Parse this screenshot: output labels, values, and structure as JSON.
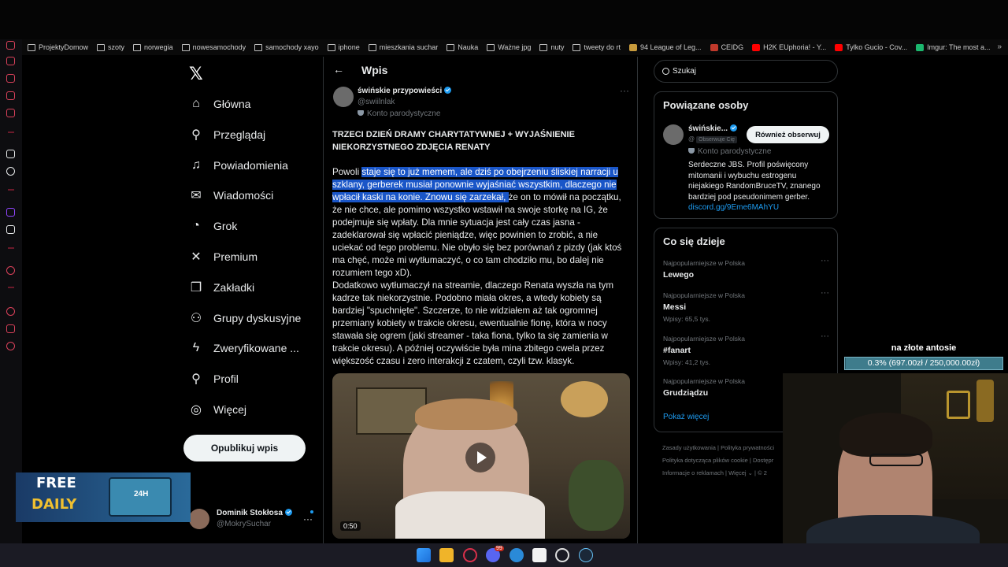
{
  "bookmarks": [
    {
      "label": "ProjektyDomow",
      "icon": "folder-icon"
    },
    {
      "label": "szoty",
      "icon": "folder-icon"
    },
    {
      "label": "norwegia",
      "icon": "folder-icon"
    },
    {
      "label": "nowesamochody",
      "icon": "folder-icon"
    },
    {
      "label": "samochody xayo",
      "icon": "folder-icon"
    },
    {
      "label": "iphone",
      "icon": "folder-icon"
    },
    {
      "label": "mieszkania suchar",
      "icon": "folder-icon"
    },
    {
      "label": "Nauka",
      "icon": "folder-icon"
    },
    {
      "label": "Ważne jpg",
      "icon": "folder-icon"
    },
    {
      "label": "nuty",
      "icon": "folder-icon"
    },
    {
      "label": "tweety do rt",
      "icon": "folder-icon"
    },
    {
      "label": "94 League of Leg...",
      "icon": "league-icon"
    },
    {
      "label": "CEIDG",
      "icon": "ceidg-icon"
    },
    {
      "label": "H2K EUphoria! - Y...",
      "icon": "youtube-icon"
    },
    {
      "label": "Tylko Gucio - Cov...",
      "icon": "youtube-icon"
    },
    {
      "label": "Imgur: The most a...",
      "icon": "imgur-icon"
    }
  ],
  "bookmarks_more": "»",
  "nav": {
    "items": [
      {
        "label": "Główna",
        "icon": "home-icon"
      },
      {
        "label": "Przeglądaj",
        "icon": "search-icon"
      },
      {
        "label": "Powiadomienia",
        "icon": "bell-icon"
      },
      {
        "label": "Wiadomości",
        "icon": "mail-icon"
      },
      {
        "label": "Grok",
        "icon": "grok-icon"
      },
      {
        "label": "Premium",
        "icon": "x-logo-icon"
      },
      {
        "label": "Zakładki",
        "icon": "bookmark-icon"
      },
      {
        "label": "Grupy dyskusyjne",
        "icon": "people-icon"
      },
      {
        "label": "Zweryfikowane ...",
        "icon": "lightning-icon"
      },
      {
        "label": "Profil",
        "icon": "person-icon"
      },
      {
        "label": "Więcej",
        "icon": "more-circle-icon"
      }
    ],
    "post_button": "Opublikuj wpis",
    "account": {
      "name": "Dominik Stokłosa",
      "handle": "@MokrySuchar",
      "menu": "···"
    }
  },
  "main": {
    "back": "←",
    "title": "Wpis",
    "author": {
      "name": "świńskie przypowieści",
      "handle": "@swiilnlak",
      "label": "Konto parodystyczne",
      "menu": "···"
    },
    "heading": "TRZECI DZIEŃ DRAMY CHARYTATYWNEJ + WYJAŚNIENIE NIEKORZYSTNEGO ZDJĘCIA RENATY",
    "body_start": "Powoli ",
    "body_highlight": "staje się to już memem, ale dziś po obejrzeniu śliskiej narracji u szklany, gerberek musiał ponownie wyjaśniać wszystkim, dlaczego nie wpłacił kaski na konie. Znowu się zarzekał, ",
    "body_rest": "że on to mówił na początku, że nie chce, ale pomimo wszystko wstawił na swoje storkę na IG, że podejmuje się wpłaty. Dla mnie sytuacja jest cały czas jasna - zadeklarował się wpłacić pieniądze, więc powinien to zrobić, a nie uciekać od tego problemu. Nie obyło się bez porównań z pizdy (jak ktoś ma chęć, może mi wytłumaczyć, o co tam chodziło mu, bo dalej nie rozumiem tego xD).",
    "body_p2": "Dodatkowo wytłumaczył na streamie, dlaczego Renata wyszła na tym kadrze tak niekorzystnie. Podobno miała okres, a wtedy kobiety są bardziej \"spuchnięte\". Szczerze, to nie widziałem aż tak ogromnej przemiany kobiety w trakcie okresu, ewentualnie fionę, która w nocy stawała się ogrem (jaki streamer - taka fiona, tylko ta się zamienia w trakcie okresu). A później oczywiście była mina zbitego cwela przez większość czasu i zero interakcji z czatem, czyli tzw. klasyk.",
    "video_duration": "0:50"
  },
  "search": {
    "value": "Szukaj"
  },
  "related": {
    "title": "Powiązane osoby",
    "name": "świńskie...",
    "handle": "@",
    "follows_badge": "Obserwuje Cię",
    "follow_button": "Również obserwuj",
    "label": "Konto parodystyczne",
    "bio": "Serdeczne JBS. Profil poświęcony mitomanii i wybuchu estrogenu niejakiego RandomBruceTV, znanego bardziej pod pseudonimem gerber.",
    "link": "discord.gg/9Eme6MAhYU"
  },
  "trends": {
    "title": "Co się dzieje",
    "items": [
      {
        "context": "Najpopularniejsze w Polska",
        "topic": "Lewego",
        "count": ""
      },
      {
        "context": "Najpopularniejsze w Polska",
        "topic": "Messi",
        "count": "Wpisy: 65,5 tys."
      },
      {
        "context": "Najpopularniejsze w Polska",
        "topic": "#fanart",
        "count": "Wpisy: 41,2 tys."
      },
      {
        "context": "Najpopularniejsze w Polska",
        "topic": "Grudziądzu",
        "count": ""
      }
    ],
    "show_more": "Pokaż więcej",
    "menu": "···"
  },
  "footer": {
    "terms": "Zasady użytkowania",
    "privacy": "Polityka prywatności",
    "cookies": "Polityka dotycząca plików cookie",
    "access": "Dostępr",
    "ads": "Informacje o reklamach",
    "more": "Więcej ⌄",
    "copy": "© 2"
  },
  "stream": {
    "goal_title": "na złote antosie",
    "goal_text": "0.3% (697.00zł / 250,000.00zł)",
    "goal_progress": 0.003,
    "promo_free": "FREE",
    "promo_daily": "DAILY",
    "promo_box": "24H"
  },
  "colors": {
    "accent": "#1d9bf0",
    "highlight": "#1a56c8",
    "background": "#000000",
    "border": "#2f3336"
  }
}
